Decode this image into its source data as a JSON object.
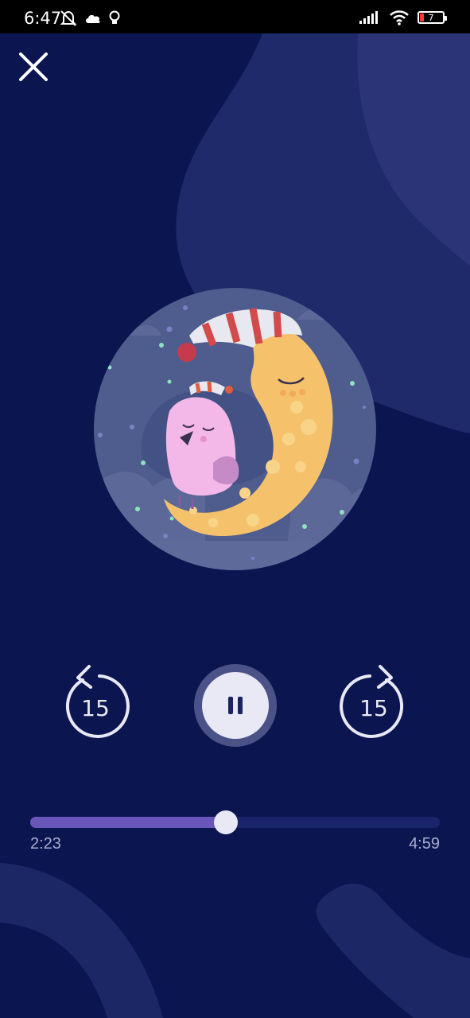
{
  "status_bar": {
    "time": "6:47",
    "battery_level": "7",
    "left_icons": [
      "muted-bell-icon",
      "cloud-icon",
      "lightbulb-icon"
    ],
    "right_icons": [
      "signal-icon",
      "wifi-icon",
      "battery-icon"
    ]
  },
  "player": {
    "close_icon": "close-icon",
    "artwork": "sleeping-bird-on-moon-illustration",
    "skip_back_label": "15",
    "skip_forward_label": "15",
    "pause_icon": "pause-icon",
    "elapsed": "2:23",
    "duration": "4:59",
    "progress_fraction": 0.478
  },
  "colors": {
    "background": "#0b1650",
    "accent": "#6a55b8",
    "control": "#e9e8f5"
  }
}
